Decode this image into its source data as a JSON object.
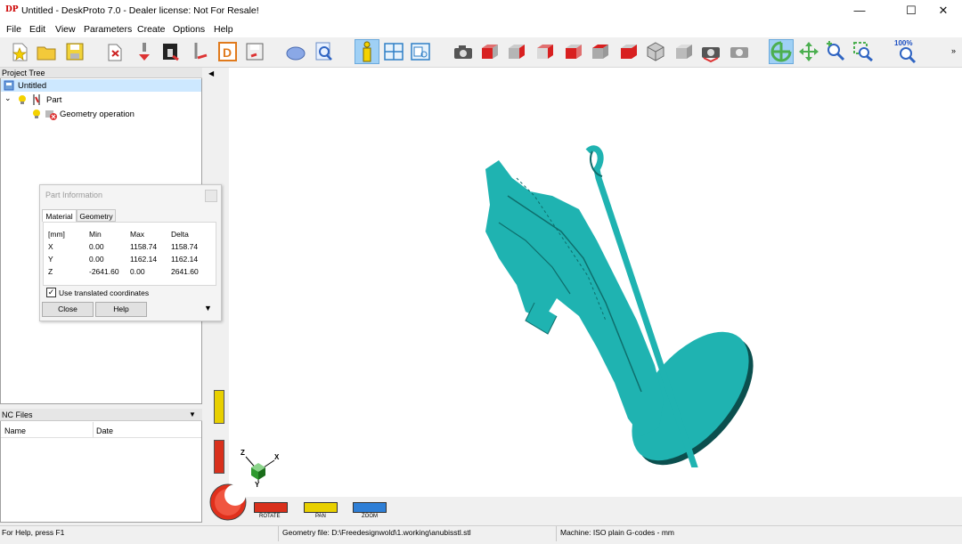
{
  "window": {
    "title": "Untitled - DeskProto 7.0 - Dealer license: Not For Resale!",
    "logo_text": "DP",
    "minimize": "—",
    "maximize": "☐",
    "close": "✕"
  },
  "menu": [
    "File",
    "Edit",
    "View",
    "Parameters",
    "Create",
    "Options",
    "Help"
  ],
  "toolbar": {
    "zoom_percent_label": "100%",
    "icons": [
      "new-file-icon",
      "open-folder-icon",
      "save-icon",
      "import-part-icon",
      "import-cutter-icon",
      "bitmap-icon",
      "tool-icon",
      "dxf-icon",
      "save-as-icon",
      "shade-icon",
      "search-icon",
      "info-icon",
      "layout-icon",
      "window-icon",
      "camera-icon",
      "view-front-icon",
      "view-right-icon",
      "view-back-icon",
      "view-left-icon",
      "view-top-icon",
      "view-bottom-icon",
      "view-iso-icon",
      "view-iso2-icon",
      "camera-rotate-icon",
      "camera-reset-icon",
      "rotate-icon",
      "pan-icon",
      "zoom-in-icon",
      "zoom-window-icon",
      "zoom-100-icon"
    ]
  },
  "project_tree": {
    "header": "Project Tree",
    "root": "Untitled",
    "part": "Part",
    "operation": "Geometry operation"
  },
  "nc_files": {
    "header": "NC Files",
    "columns": [
      "Name",
      "Date"
    ]
  },
  "part_info": {
    "title": "Part Information",
    "tabs": [
      "Material",
      "Geometry"
    ],
    "columns": [
      "[mm]",
      "Min",
      "Max",
      "Delta"
    ],
    "rows": [
      {
        "axis": "X",
        "min": "0.00",
        "max": "1158.74",
        "delta": "1158.74"
      },
      {
        "axis": "Y",
        "min": "0.00",
        "max": "1162.14",
        "delta": "1162.14"
      },
      {
        "axis": "Z",
        "min": "-2641.60",
        "max": "0.00",
        "delta": "2641.60"
      }
    ],
    "checkbox_label": "Use translated coordinates",
    "checkbox_checked": true,
    "close_button": "Close",
    "help_button": "Help"
  },
  "viewport": {
    "model_color": "#1fb3b1",
    "axis_labels": {
      "z": "Z",
      "x": "X",
      "y": "Y"
    },
    "mouse_modes": [
      "ROTATE",
      "PAN",
      "ZOOM"
    ]
  },
  "status": {
    "help": "For Help, press F1",
    "geometry_file": "Geometry file: D:\\Freedesignwold\\1.working\\anubisstl.stl",
    "machine": "Machine: ISO plain G-codes - mm"
  }
}
